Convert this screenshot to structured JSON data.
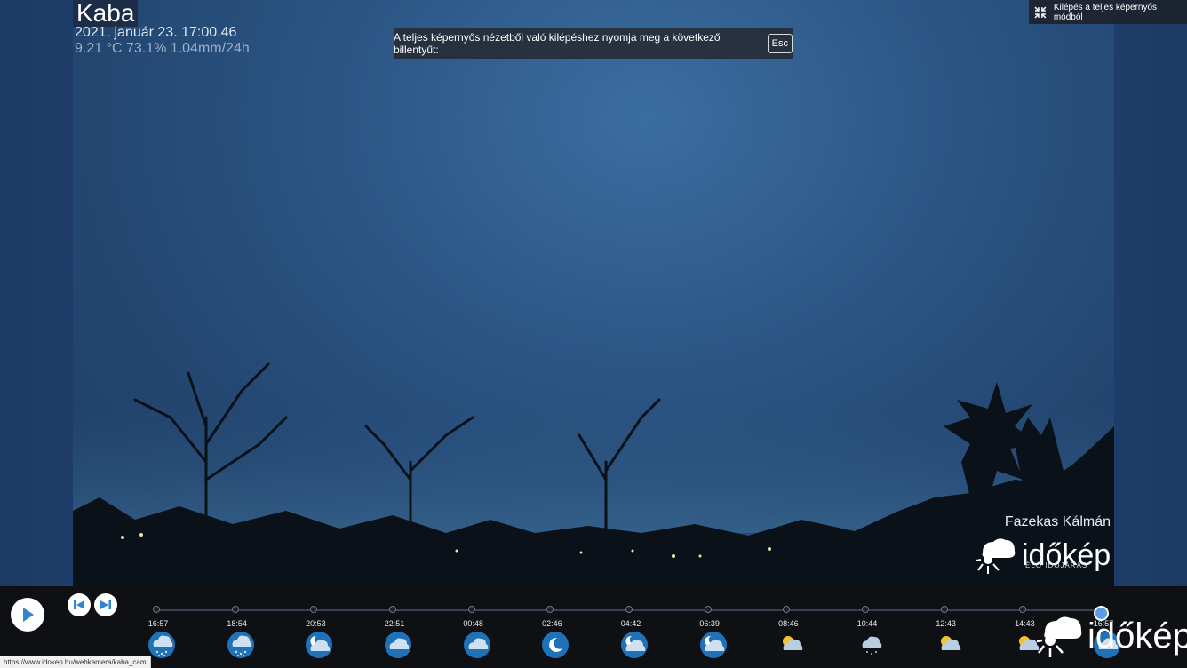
{
  "camera": {
    "title": "Kaba",
    "datetime": "2021. január 23. 17:00.46",
    "measurements": "9.21 °C 73.1% 1.04mm/24h",
    "author": "Fazekas Kálmán",
    "logo_text": "időkép",
    "logo_subtext": "ÉLŐ IDŐJÁRÁS"
  },
  "fullscreen_notice": {
    "text": "A teljes képernyős nézetből való kilépéshez nyomja meg a következő billentyűt:",
    "key": "Esc"
  },
  "exit_fullscreen": {
    "label": "Kilépés a teljes képernyős módból",
    "icon": "exit-fullscreen-icon"
  },
  "timeline": {
    "play_icon": "play-icon",
    "prev_icon": "skip-back-icon",
    "next_icon": "skip-forward-icon",
    "logo_text": "időkép",
    "steps": [
      {
        "time": "16:57",
        "icon": "rain-cloud"
      },
      {
        "time": "18:54",
        "icon": "rain-cloud"
      },
      {
        "time": "20:53",
        "icon": "night-partly-cloudy"
      },
      {
        "time": "22:51",
        "icon": "cloud"
      },
      {
        "time": "00:48",
        "icon": "cloud"
      },
      {
        "time": "02:46",
        "icon": "moon"
      },
      {
        "time": "04:42",
        "icon": "night-partly-cloudy"
      },
      {
        "time": "06:39",
        "icon": "night-partly-cloudy"
      },
      {
        "time": "08:46",
        "icon": "sun-cloud"
      },
      {
        "time": "10:44",
        "icon": "drizzle-cloud"
      },
      {
        "time": "12:43",
        "icon": "sun-cloud"
      },
      {
        "time": "14:43",
        "icon": "sun-cloud"
      },
      {
        "time": "16:57",
        "icon": "cloud"
      }
    ],
    "current_index": 12
  },
  "status_bar": {
    "url": "https://www.idokep.hu/webkamera/kaba_cam"
  }
}
